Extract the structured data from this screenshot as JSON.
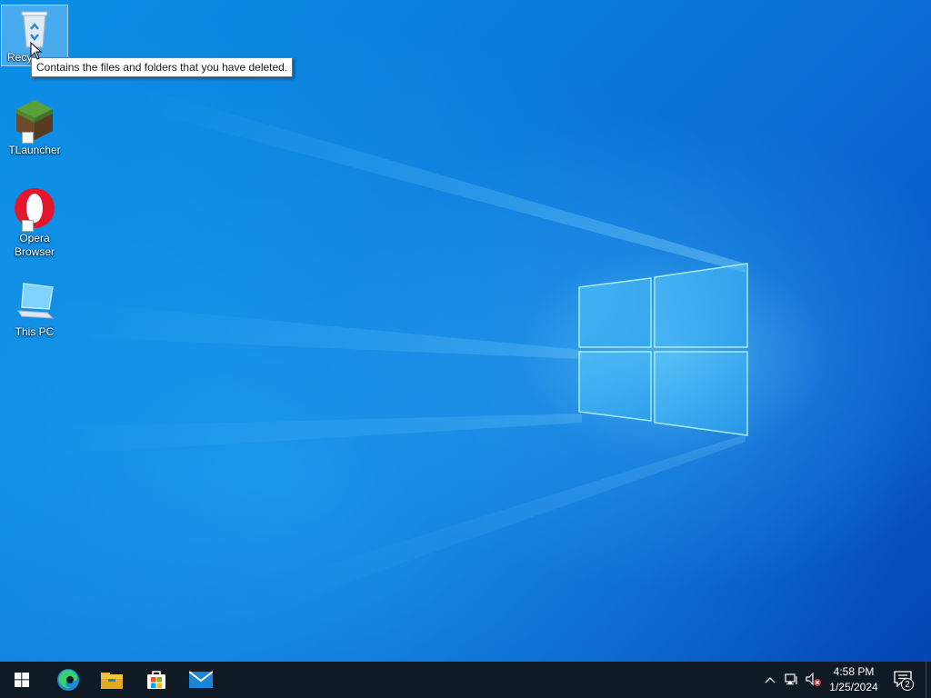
{
  "desktop": {
    "icons": [
      {
        "label": "Recycle Bin",
        "visible_label": "Recy",
        "icon": "recycle-bin-icon",
        "selected": true
      },
      {
        "label": "TLauncher",
        "icon": "tlauncher-icon",
        "shortcut": true
      },
      {
        "label": "Opera\nBrowser",
        "icon": "opera-icon",
        "shortcut": true
      },
      {
        "label": "This PC",
        "icon": "this-pc-icon"
      }
    ],
    "tooltip": "Contains the files and folders that you have deleted."
  },
  "taskbar": {
    "start_icon": "windows-start-icon",
    "pinned": [
      {
        "name": "Microsoft Edge",
        "icon": "edge-icon"
      },
      {
        "name": "File Explorer",
        "icon": "file-explorer-icon"
      },
      {
        "name": "Microsoft Store",
        "icon": "store-icon"
      },
      {
        "name": "Mail",
        "icon": "mail-icon"
      }
    ],
    "tray": {
      "icons": [
        "chevron-up-icon",
        "network-icon",
        "volume-muted-icon"
      ],
      "time": "4:58 PM",
      "date": "1/25/2024",
      "notifications_count": "2"
    }
  },
  "colors": {
    "taskbar_bg": "#0f1a24",
    "wallpaper_blue": "#0a7fdd",
    "logo_glow": "#7fd9ff"
  }
}
